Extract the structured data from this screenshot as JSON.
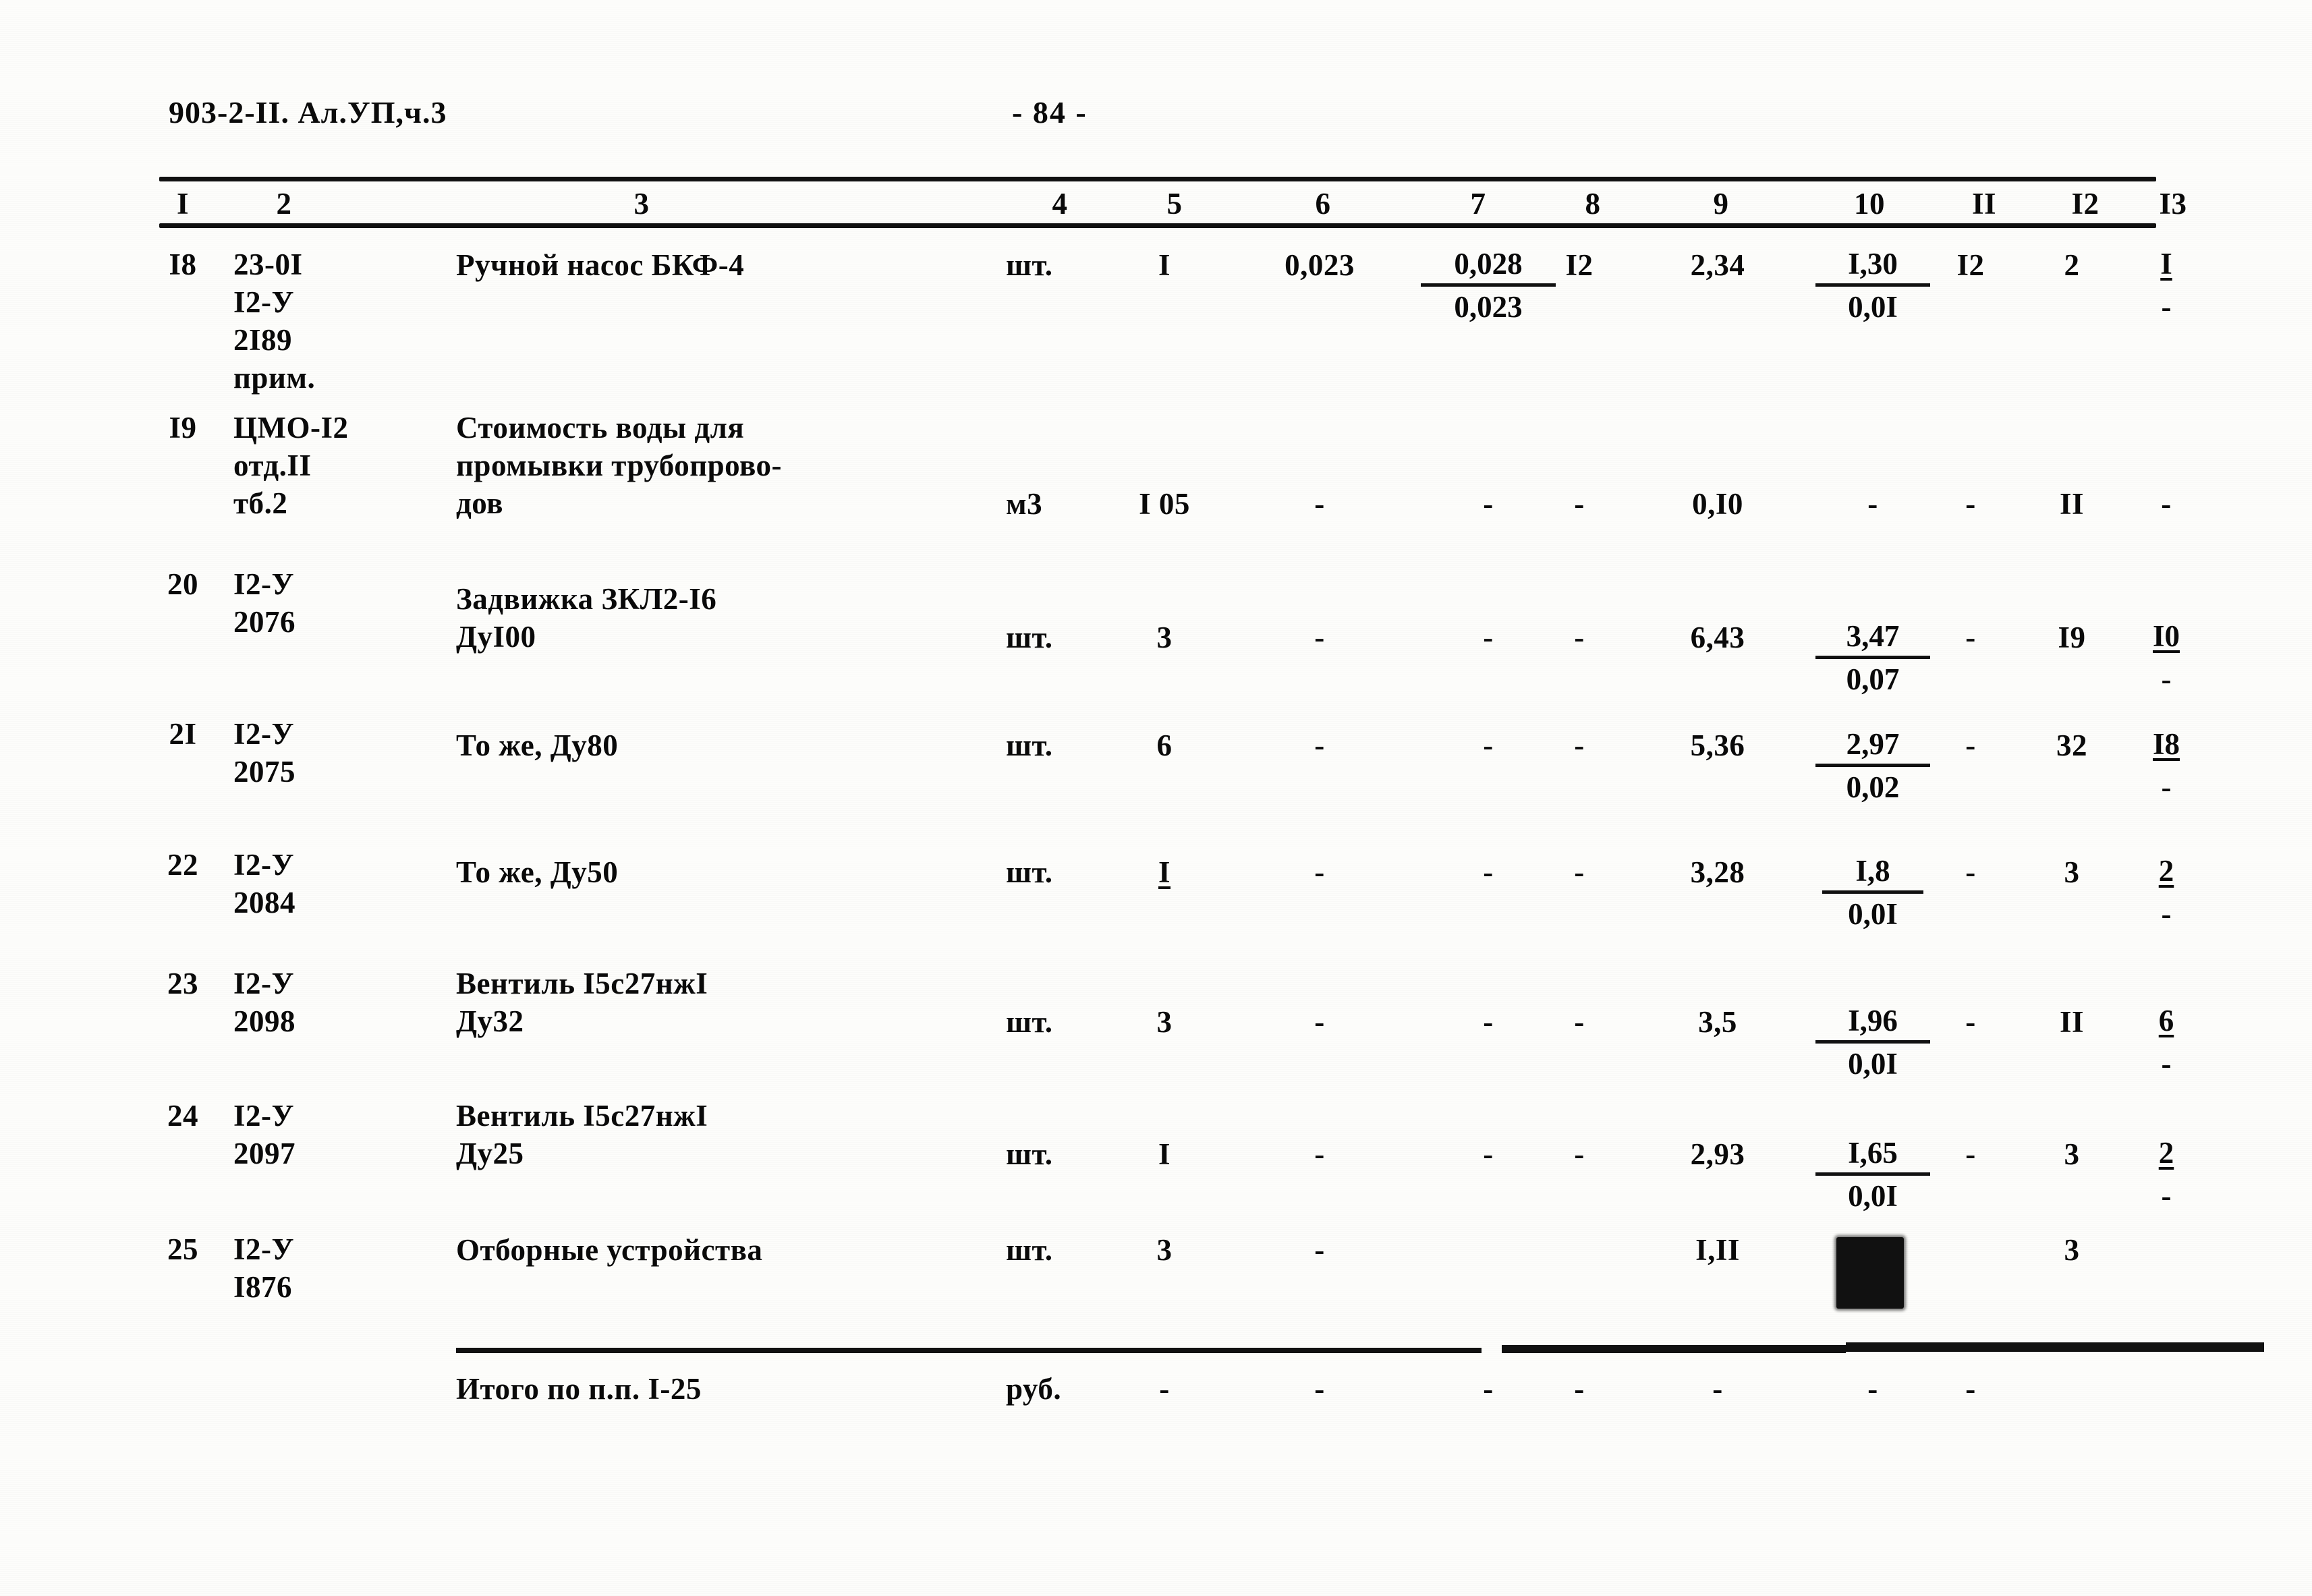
{
  "header": {
    "doc_code": "903-2-II. Ал.УП,ч.3",
    "page_number": "- 84 -"
  },
  "table": {
    "column_headers": [
      "I",
      "2",
      "3",
      "4",
      "5",
      "6",
      "7",
      "8",
      "9",
      "10",
      "II",
      "I2",
      "I3"
    ],
    "rows": [
      {
        "num": "I8",
        "code": "23-0I\nI2-У\n2I89\nприм.",
        "name": "Ручной насос БКФ-4",
        "unit": "шт.",
        "qty": "I",
        "c6": "0,023",
        "c7_num": "0,028",
        "c7_den": "0,023",
        "c8": "I2",
        "c9": "2,34",
        "c10_num": "I,30",
        "c10_den": "0,0I",
        "c11": "I2",
        "c12": "2",
        "c13_num": "I",
        "c13_den": "-"
      },
      {
        "num": "I9",
        "code": "ЦМО-I2\nотд.II\nтб.2",
        "name": "Стоимость воды для\nпромывки трубопрово-\nдов",
        "unit": "м3",
        "qty": "I 05",
        "c6": "-",
        "c7": "-",
        "c8": "-",
        "c9": "0,I0",
        "c10": "-",
        "c11": "-",
        "c12": "II",
        "c13": "-"
      },
      {
        "num": "20",
        "code": "I2-У\n2076",
        "name": "Задвижка ЗКЛ2-I6\nДуI00",
        "unit": "шт.",
        "qty": "3",
        "c6": "-",
        "c7": "-",
        "c8": "-",
        "c9": "6,43",
        "c10_num": "3,47",
        "c10_den": "0,07",
        "c11": "-",
        "c12": "I9",
        "c13_num": "I0",
        "c13_den": "-"
      },
      {
        "num": "2I",
        "code": "I2-У\n2075",
        "name": "То же, Ду80",
        "unit": "шт.",
        "qty": "6",
        "c6": "-",
        "c7": "-",
        "c8": "-",
        "c9": "5,36",
        "c10_num": "2,97",
        "c10_den": "0,02",
        "c11": "-",
        "c12": "32",
        "c13_num": "I8",
        "c13_den": "-"
      },
      {
        "num": "22",
        "code": "I2-У\n2084",
        "name": "То же, Ду50",
        "unit": "шт.",
        "qty": "I",
        "c6": "-",
        "c7": "-",
        "c8": "-",
        "c9": "3,28",
        "c10_num": "I,8",
        "c10_den": "0,0I",
        "c11": "-",
        "c12": "3",
        "c13_num": "2",
        "c13_den": "-"
      },
      {
        "num": "23",
        "code": "I2-У\n2098",
        "name": "Вентиль I5с27нжI\nДу32",
        "unit": "шт.",
        "qty": "3",
        "c6": "-",
        "c7": "-",
        "c8": "-",
        "c9": "3,5",
        "c10_num": "I,96",
        "c10_den": "0,0I",
        "c11": "-",
        "c12": "II",
        "c13_num": "6",
        "c13_den": "-"
      },
      {
        "num": "24",
        "code": "I2-У\n2097",
        "name": "Вентиль I5с27нжI\nДу25",
        "unit": "шт.",
        "qty": "I",
        "c6": "-",
        "c7": "-",
        "c8": "-",
        "c9": "2,93",
        "c10_num": "I,65",
        "c10_den": "0,0I",
        "c11": "-",
        "c12": "3",
        "c13_num": "2",
        "c13_den": "-"
      },
      {
        "num": "25",
        "code": "I2-У\nI876",
        "name": "Отборные устройства",
        "unit": "шт.",
        "qty": "3",
        "c6": "-",
        "c9": "I,II",
        "c10": "",
        "c12": "3"
      }
    ],
    "total_row": {
      "label": "Итого по п.п. I-25",
      "unit": "руб.",
      "values": [
        "-",
        "-",
        "-",
        "-",
        "-",
        "-",
        "-"
      ]
    }
  }
}
